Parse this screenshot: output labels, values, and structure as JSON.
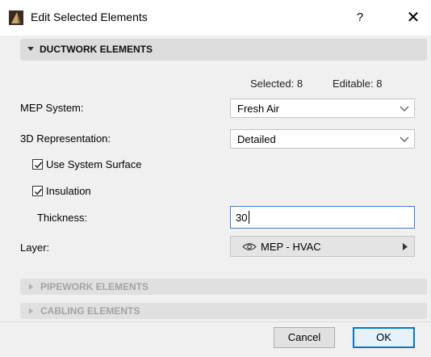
{
  "window": {
    "title": "Edit Selected Elements",
    "help_label": "?",
    "close_label": "✕"
  },
  "sections": {
    "ductwork": {
      "label": "DUCTWORK ELEMENTS",
      "expanded": true
    },
    "pipework": {
      "label": "PIPEWORK ELEMENTS",
      "expanded": false
    },
    "cabling": {
      "label": "CABLING ELEMENTS",
      "expanded": false
    }
  },
  "selection": {
    "selected": "Selected: 8",
    "editable": "Editable: 8"
  },
  "fields": {
    "mep_system": {
      "label": "MEP System:",
      "value": "Fresh Air"
    },
    "representation": {
      "label": "3D Representation:",
      "value": "Detailed"
    },
    "use_system_surface": {
      "label": "Use System Surface",
      "checked": true
    },
    "insulation": {
      "label": "Insulation",
      "checked": true
    },
    "thickness": {
      "label": "Thickness:",
      "value": "30"
    },
    "layer": {
      "label": "Layer:",
      "value": "MEP - HVAC",
      "icon": "eye-icon"
    }
  },
  "buttons": {
    "cancel": "Cancel",
    "ok": "OK"
  },
  "colors": {
    "accent": "#0078d7",
    "field_focus": "#3c7ed4",
    "section_bg": "#dcdcdc"
  }
}
